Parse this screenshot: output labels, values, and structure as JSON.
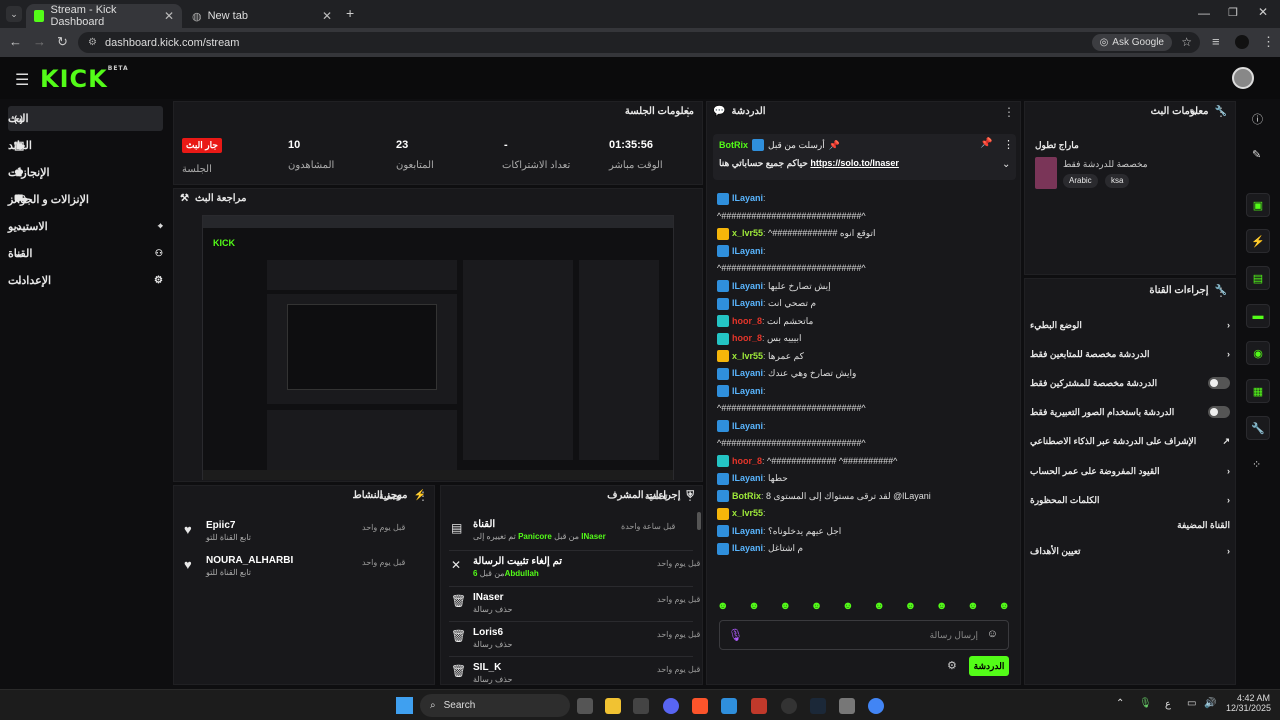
{
  "browser": {
    "tabs": [
      {
        "label": "Stream - Kick Dashboard",
        "active": true
      },
      {
        "label": "New tab",
        "active": false
      }
    ],
    "url": "dashboard.kick.com/stream",
    "ask_google": "Ask Google"
  },
  "brand": {
    "logo": "KICK",
    "beta": "BETA",
    "accent": "#53fc18"
  },
  "sidebar": {
    "items": [
      {
        "label": "البث",
        "icon": "broadcast-icon",
        "active": true
      },
      {
        "label": "العائد",
        "icon": "wallet-icon"
      },
      {
        "label": "الإنجازات",
        "icon": "trophy-icon"
      },
      {
        "label": "الإنزالات و الجوائز",
        "icon": "gift-icon"
      },
      {
        "label": "الاستيديو",
        "icon": "studio-icon"
      },
      {
        "label": "القناة",
        "icon": "channel-icon"
      },
      {
        "label": "الإعدادات",
        "icon": "gear-icon"
      }
    ]
  },
  "session": {
    "title": "معلومات الجلسة",
    "live_badge": "جار البث",
    "stats": [
      {
        "value": "01:35:56",
        "label": "الوقت مباشر"
      },
      {
        "value": "-",
        "label": "تعداد الاشتراكات"
      },
      {
        "value": "23",
        "label": "المتابعون"
      },
      {
        "value": "10",
        "label": "المشاهدون"
      },
      {
        "value": "",
        "label": "الجلسة"
      }
    ]
  },
  "preview": {
    "title": "مراجعة البث"
  },
  "activity": {
    "title": "موجز النشاط",
    "filter": "تصفية",
    "items": [
      {
        "name": "Epiic7",
        "sub": "تابع القناة للتو",
        "time": "قبل يوم واحد"
      },
      {
        "name": "NOURA_ALHARBI",
        "sub": "تابع القناة للتو",
        "time": "قبل يوم واحد"
      }
    ]
  },
  "mod_actions": {
    "title": "إجراءات المشرف",
    "filter": "تصفية",
    "items": [
      {
        "title": "القناة",
        "sub_prefix": "تم تغييره إلى",
        "sub_user": "Panicore",
        "sub_mid": "من قبل",
        "sub_by": "INaser",
        "time": "قبل ساعة واحدة"
      },
      {
        "title": "تم إلغاء تثبيت الرسالة",
        "sub_prefix": "من قبل",
        "sub_user": "6Abdullah",
        "time": "قبل يوم واحد"
      },
      {
        "title": "INaser",
        "sub_prefix": "حذف رسالة",
        "time": "قبل يوم واحد"
      },
      {
        "title": "Loris6",
        "sub_prefix": "حذف رسالة",
        "time": "قبل يوم واحد"
      },
      {
        "title": "SIL_K",
        "sub_prefix": "حذف رسالة",
        "time": "قبل يوم واحد"
      }
    ]
  },
  "chat": {
    "title": "الدردشة",
    "pinned_by": "أرسلت من قبل",
    "pinned_user": "BotRix",
    "pinned_text": "حياكم جميع حساباتي هنا",
    "pinned_link": "https://solo.to/lnaser",
    "messages": [
      {
        "user": "lLayani",
        "text": ""
      },
      {
        "user": "",
        "text": "^############################^"
      },
      {
        "user": "x_lvr55",
        "text": "^############# اتوقع انوه"
      },
      {
        "user": "lLayani",
        "text": ""
      },
      {
        "user": "",
        "text": "^############################^"
      },
      {
        "user": "lLayani",
        "text": "إيش تصارخ عليها"
      },
      {
        "user": "lLayani",
        "text": "م تصحي انت"
      },
      {
        "user": "hoor_8",
        "text": "ماتحشم انت"
      },
      {
        "user": "hoor_8",
        "text": "ابيييه بس"
      },
      {
        "user": "x_lvr55",
        "text": "كم عمرها"
      },
      {
        "user": "lLayani",
        "text": "وايش تصارخ وهي عندك"
      },
      {
        "user": "lLayani",
        "text": ""
      },
      {
        "user": "",
        "text": "^############################^"
      },
      {
        "user": "lLayani",
        "text": ""
      },
      {
        "user": "",
        "text": "^############################^"
      },
      {
        "user": "hoor_8",
        "text": "^############# ^##########^"
      },
      {
        "user": "lLayani",
        "text": "حطها"
      },
      {
        "user": "BotRix",
        "text": "لقد ترقى مستواك إلى المستوى 8 @lLayani"
      },
      {
        "user": "x_lvr55",
        "text": ""
      },
      {
        "user": "lLayani",
        "text": "اجل عيهم يدخلوناه؟"
      },
      {
        "user": "lLayani",
        "text": "م اشتاغل"
      }
    ],
    "input_placeholder": "إرسال رسالة",
    "send_label": "الدردشة"
  },
  "stream_info": {
    "title": "معلومات البث",
    "stream_title": "ماراج تطول",
    "category": "مخصصة للدردشة فقط",
    "tags": [
      "Arabic",
      "ksa"
    ]
  },
  "channel_actions": {
    "title": "إجراءات القناة",
    "items": [
      {
        "label": "الوضع البطيء",
        "control": "chevron"
      },
      {
        "label": "الدردشة مخصصة للمتابعين فقط",
        "control": "chevron"
      },
      {
        "label": "الدردشة مخصصة للمشتركين فقط",
        "control": "toggle"
      },
      {
        "label": "الدردشة باستخدام الصور التعبيرية فقط",
        "control": "toggle"
      },
      {
        "label": "الإشراف على الدردشة عبر الذكاء الاصطناعي",
        "control": "external"
      },
      {
        "label": "القيود المفروضة على عمر الحساب",
        "control": "chevron"
      },
      {
        "label": "الكلمات المحظورة",
        "control": "chevron"
      },
      {
        "label": "القناة المضيفة",
        "control": "none"
      },
      {
        "label": "تعيين الأهداف",
        "control": "chevron"
      }
    ]
  },
  "taskbar": {
    "search": "Search",
    "lang": "ع",
    "time": "4:42 AM",
    "date": "12/31/2025"
  }
}
